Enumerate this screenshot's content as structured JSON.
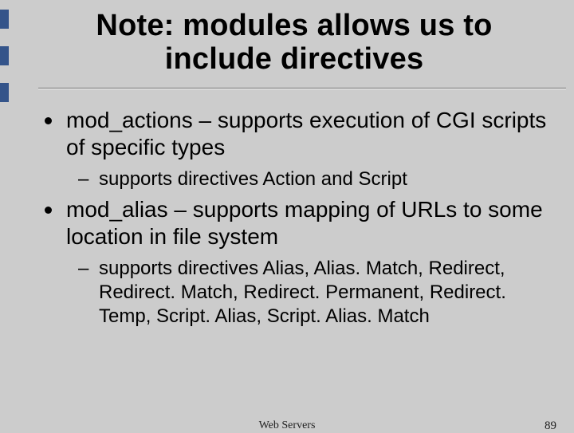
{
  "title_line1": "Note: modules allows us to",
  "title_line2": "include directives",
  "bullets": [
    {
      "text": "mod_actions – supports execution of CGI scripts of specific types",
      "sub": [
        "supports directives Action and Script"
      ]
    },
    {
      "text": "mod_alias – supports mapping of URLs to some location in file system",
      "sub": [
        "supports directives Alias, Alias. Match, Redirect, Redirect. Match, Redirect. Permanent, Redirect. Temp, Script. Alias, Script. Alias. Match"
      ]
    }
  ],
  "footer": {
    "center": "Web Servers",
    "page": "89"
  }
}
